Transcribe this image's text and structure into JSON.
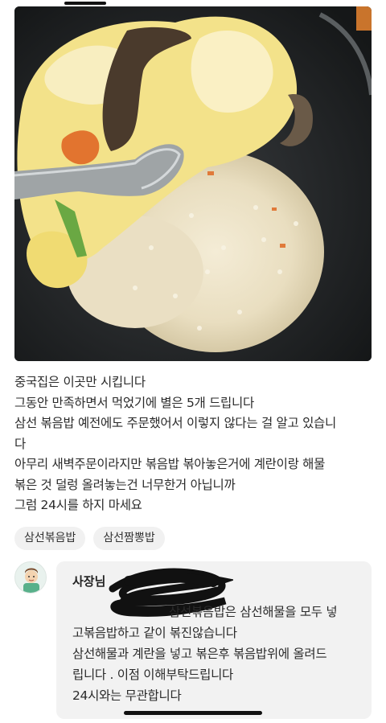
{
  "review": {
    "lines": [
      "중국집은 이곳만 시킵니다",
      "그동안 만족하면서 먹었기에 별은 5개 드립니다",
      "삼선 볶음밥 예전에도 주문했어서 이렇지 않다는 걸 알고 있습니",
      "다",
      "아무리 새벽주문이라지만 볶음밥 볶아놓은거에 계란이랑 해물",
      "볶은 것 덜렁 올려놓는건 너무한거 아닙니까",
      "그럼 24시를 하지 마세요"
    ]
  },
  "tags": [
    "삼선볶음밥",
    "삼선짬뽕밥"
  ],
  "owner_reply": {
    "name": "사장님",
    "lines": [
      "삼선볶음밥은 삼선해물을 모두 넣",
      "고볶음밥하고 같이  볶진않습니다",
      "삼선해물과 계란을 넣고 볶은후 볶음밥위에 올려드",
      "립니다 . 이점 이해부탁드립니다",
      "24시와는 무관합니다"
    ]
  },
  "photo": {
    "description_icon": "food-photo"
  }
}
